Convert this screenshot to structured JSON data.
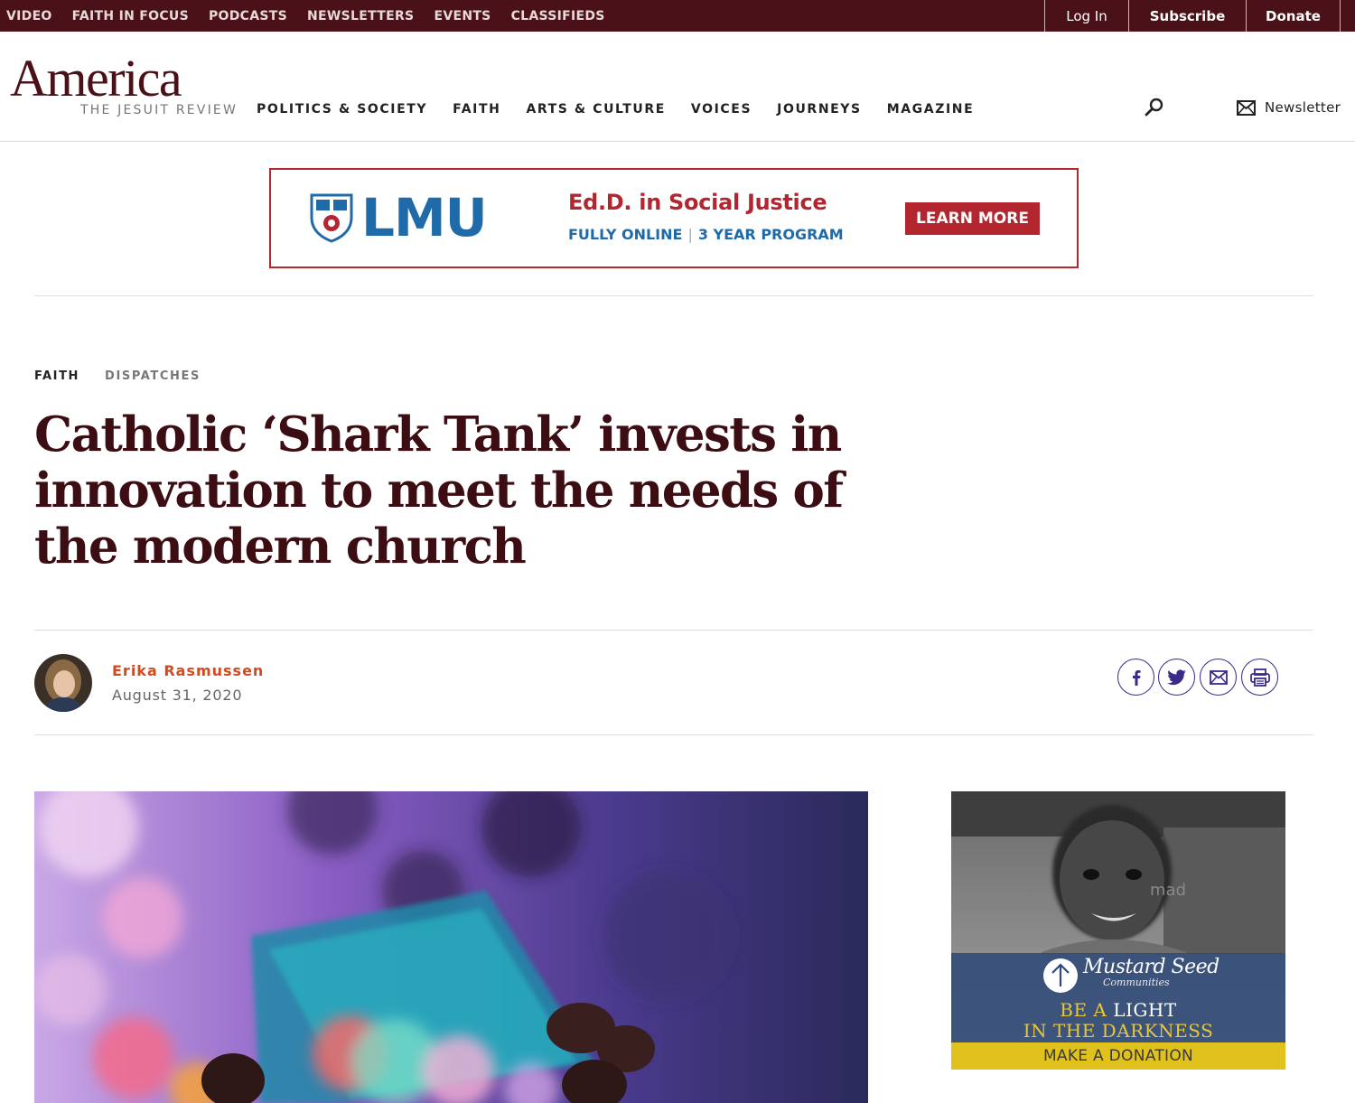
{
  "topbar": {
    "links": [
      "VIDEO",
      "FAITH IN FOCUS",
      "PODCASTS",
      "NEWSLETTERS",
      "EVENTS",
      "CLASSIFIEDS"
    ],
    "login": "Log In",
    "subscribe": "Subscribe",
    "donate": "Donate"
  },
  "header": {
    "logo_wordmark": "America",
    "logo_tagline": "THE JESUIT REVIEW",
    "nav": [
      "POLITICS & SOCIETY",
      "FAITH",
      "ARTS & CULTURE",
      "VOICES",
      "JOURNEYS",
      "MAGAZINE"
    ],
    "newsletter_label": "Newsletter"
  },
  "ad_banner": {
    "logo_text": "LMU",
    "headline": "Ed.D. in Social Justice",
    "sub_left": "FULLY ONLINE",
    "sub_sep": "|",
    "sub_right": "3 YEAR PROGRAM",
    "cta": "LEARN MORE"
  },
  "article": {
    "kicker_primary": "FAITH",
    "kicker_secondary": "DISPATCHES",
    "title": "Catholic ‘Shark Tank’ invests in innovation to meet the needs of the modern church",
    "author": "Erika Rasmussen",
    "date": "August 31, 2020"
  },
  "side_ad": {
    "org_name": "Mustard Seed",
    "org_sub": "Communities",
    "line1_a": "BE A",
    "line1_b": "LIGHT",
    "line2": "IN THE DARKNESS",
    "cta": "MAKE A DONATION",
    "photo_text": "mad"
  },
  "colors": {
    "topbar_bg": "#4a1218",
    "headline": "#3c0d12",
    "author": "#d24a1e",
    "share_icons": "#3b2a8a",
    "ad_red": "#b3262f",
    "ad_blue": "#1f6aa8"
  }
}
